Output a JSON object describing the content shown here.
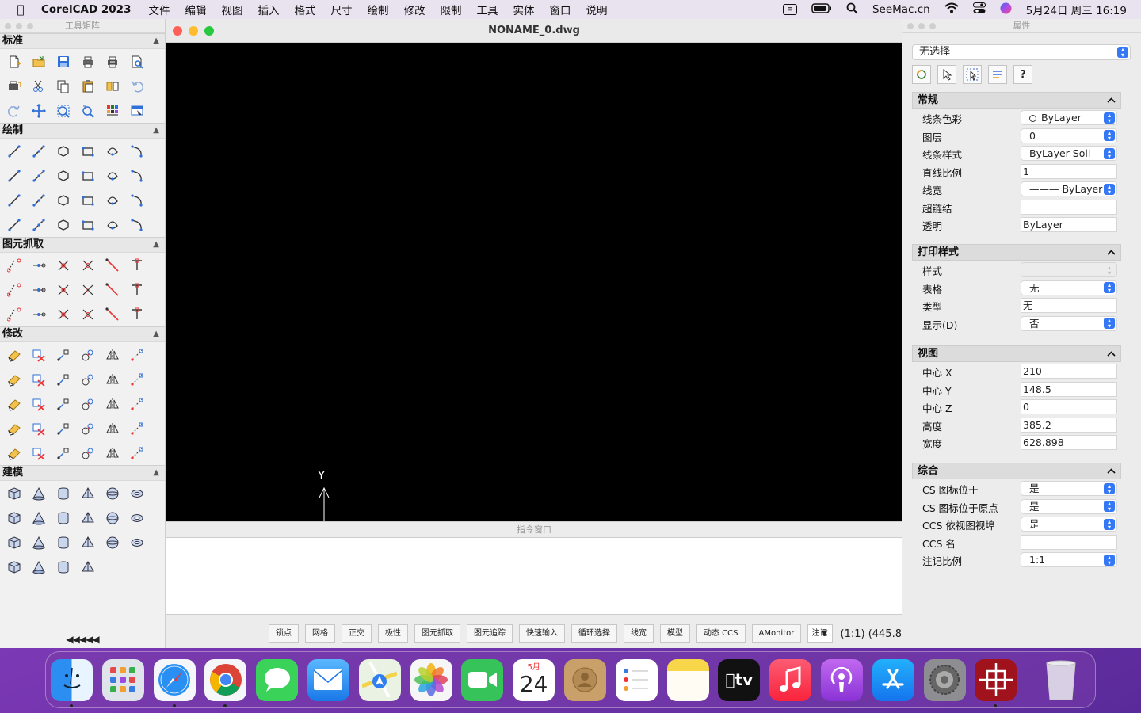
{
  "menubar": {
    "app_name": "CorelCAD 2023",
    "items": [
      "文件",
      "编辑",
      "视图",
      "插入",
      "格式",
      "尺寸",
      "绘制",
      "修改",
      "限制",
      "工具",
      "实体",
      "窗口",
      "说明"
    ],
    "site": "SeeMac.cn",
    "datetime": "5月24日 周三  16:19"
  },
  "toolbox": {
    "title": "工具矩阵",
    "sections": [
      {
        "name": "标准",
        "count": 18
      },
      {
        "name": "绘制",
        "count": 24
      },
      {
        "name": "图元抓取",
        "count": 18
      },
      {
        "name": "修改",
        "count": 30
      },
      {
        "name": "建模",
        "count": 22
      }
    ],
    "more": "◀◀◀◀◀"
  },
  "drawing": {
    "title": "NONAME_0.dwg",
    "ucs_y_label": "Y",
    "command_window_title": "指令窗口",
    "status_buttons": [
      "锁点",
      "网格",
      "正交",
      "极性",
      "图元抓取",
      "图元追踪",
      "快速输入",
      "循环选择",
      "线宽",
      "模型",
      "动态 CCS",
      "AMonitor"
    ],
    "annotation_select": "注记",
    "coords": "(1:1)  (445.8"
  },
  "properties": {
    "title": "属性",
    "selection": "无选择",
    "help_label": "?",
    "sections": {
      "general": {
        "title": "常规",
        "rows": [
          {
            "label": "线条色彩",
            "value": "ByLayer",
            "type": "dropdown",
            "swatch": true
          },
          {
            "label": "图层",
            "value": "0",
            "type": "dropdown"
          },
          {
            "label": "线条样式",
            "value": "ByLayer      Soli",
            "type": "dropdown"
          },
          {
            "label": "直线比例",
            "value": "1",
            "type": "text"
          },
          {
            "label": "线宽",
            "value": "——— ByLayer",
            "type": "dropdown"
          },
          {
            "label": "超链结",
            "value": "",
            "type": "text"
          },
          {
            "label": "透明",
            "value": "ByLayer",
            "type": "text"
          }
        ]
      },
      "print": {
        "title": "打印样式",
        "rows": [
          {
            "label": "样式",
            "value": "",
            "type": "disabled"
          },
          {
            "label": "表格",
            "value": "无",
            "type": "dropdown"
          },
          {
            "label": "类型",
            "value": "无",
            "type": "text"
          },
          {
            "label": "显示(D)",
            "value": "否",
            "type": "dropdown"
          }
        ]
      },
      "view": {
        "title": "视图",
        "rows": [
          {
            "label": "中心 X",
            "value": "210",
            "type": "text"
          },
          {
            "label": "中心 Y",
            "value": "148.5",
            "type": "text"
          },
          {
            "label": "中心 Z",
            "value": "0",
            "type": "text"
          },
          {
            "label": "高度",
            "value": "385.2",
            "type": "text"
          },
          {
            "label": "宽度",
            "value": "628.898",
            "type": "text"
          }
        ]
      },
      "misc": {
        "title": "综合",
        "rows": [
          {
            "label": "CS 图标位于",
            "value": "是",
            "type": "dropdown"
          },
          {
            "label": "CS 图标位于原点",
            "value": "是",
            "type": "dropdown"
          },
          {
            "label": "CCS 依视图视埠",
            "value": "是",
            "type": "dropdown"
          },
          {
            "label": "CCS 名",
            "value": "",
            "type": "text"
          },
          {
            "label": "注记比例",
            "value": "1:1",
            "type": "dropdown"
          }
        ]
      }
    }
  },
  "dock": {
    "calendar_month": "5月",
    "calendar_day": "24",
    "tv_label": "tv",
    "apps": [
      "finder",
      "launchpad",
      "safari",
      "chrome",
      "messages",
      "mail",
      "maps",
      "photos",
      "facetime",
      "calendar",
      "contacts",
      "reminders",
      "notes",
      "tv",
      "music",
      "podcasts",
      "app-store",
      "system-preferences",
      "corelcad",
      "trash"
    ]
  }
}
